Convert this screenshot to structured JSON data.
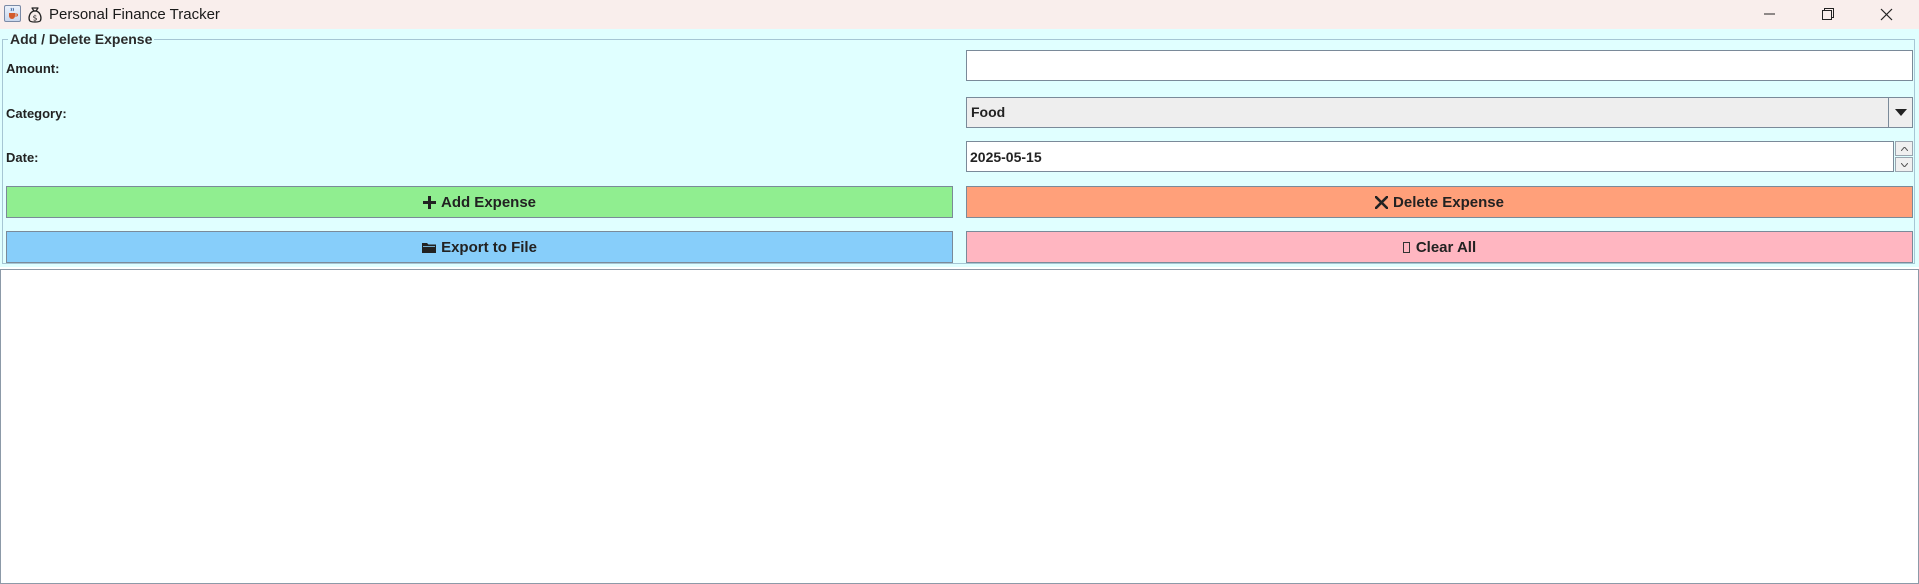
{
  "window": {
    "title": "Personal Finance Tracker",
    "icon": "java-cup-icon",
    "app_icon": "money-bag-icon",
    "controls": [
      "minimize-icon",
      "restore-icon",
      "close-icon"
    ]
  },
  "form": {
    "legend": "Add / Delete Expense",
    "amount_label": "Amount:",
    "amount_value": "",
    "category_label": "Category:",
    "category_value": "Food",
    "date_label": "Date:",
    "date_value": "2025-05-15"
  },
  "buttons": {
    "add": {
      "label": "Add Expense",
      "icon": "plus-icon",
      "color": "#90ee90"
    },
    "delete": {
      "label": "Delete Expense",
      "icon": "x-icon",
      "color": "#ffa07a"
    },
    "export": {
      "label": "Export to File",
      "icon": "folder-icon",
      "color": "#87cefa"
    },
    "clear": {
      "label": "Clear All",
      "icon": "missing-glyph-icon",
      "color": "#ffb6c1"
    }
  },
  "output": {
    "text": ""
  },
  "colors": {
    "panel_background": "#e0ffff",
    "titlebar_background": "#f9eeec"
  }
}
